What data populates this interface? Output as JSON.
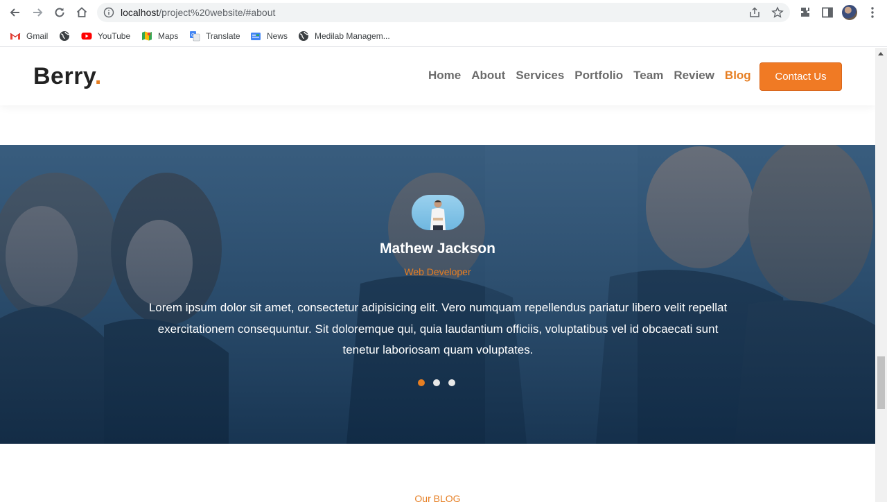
{
  "browser": {
    "url_host": "localhost",
    "url_path": "/project%20website/#about",
    "bookmarks": [
      {
        "label": "Gmail",
        "icon": "gmail-icon"
      },
      {
        "label": "",
        "icon": "globe-icon"
      },
      {
        "label": "YouTube",
        "icon": "youtube-icon"
      },
      {
        "label": "Maps",
        "icon": "maps-icon"
      },
      {
        "label": "Translate",
        "icon": "translate-icon"
      },
      {
        "label": "News",
        "icon": "news-icon"
      },
      {
        "label": "Medilab Managem...",
        "icon": "globe-icon"
      }
    ]
  },
  "site": {
    "logo_text": "Berry",
    "logo_dot": ".",
    "nav": [
      "Home",
      "About",
      "Services",
      "Portfolio",
      "Team",
      "Review",
      "Blog"
    ],
    "nav_active": "Blog",
    "contact_label": "Contact Us",
    "accent": "#e67e22"
  },
  "testimonial": {
    "name": "Mathew Jackson",
    "role": "Web Developer",
    "quote": "Lorem ipsum dolor sit amet, consectetur adipisicing elit. Vero numquam repellendus pariatur libero velit repellat exercitationem consequuntur. Sit doloremque qui, quia laudantium officiis, voluptatibus vel id obcaecati sunt tenetur laboriosam quam voluptates.",
    "slides": 3,
    "active_slide": 1
  },
  "blog": {
    "kicker": "Our BLOG"
  }
}
